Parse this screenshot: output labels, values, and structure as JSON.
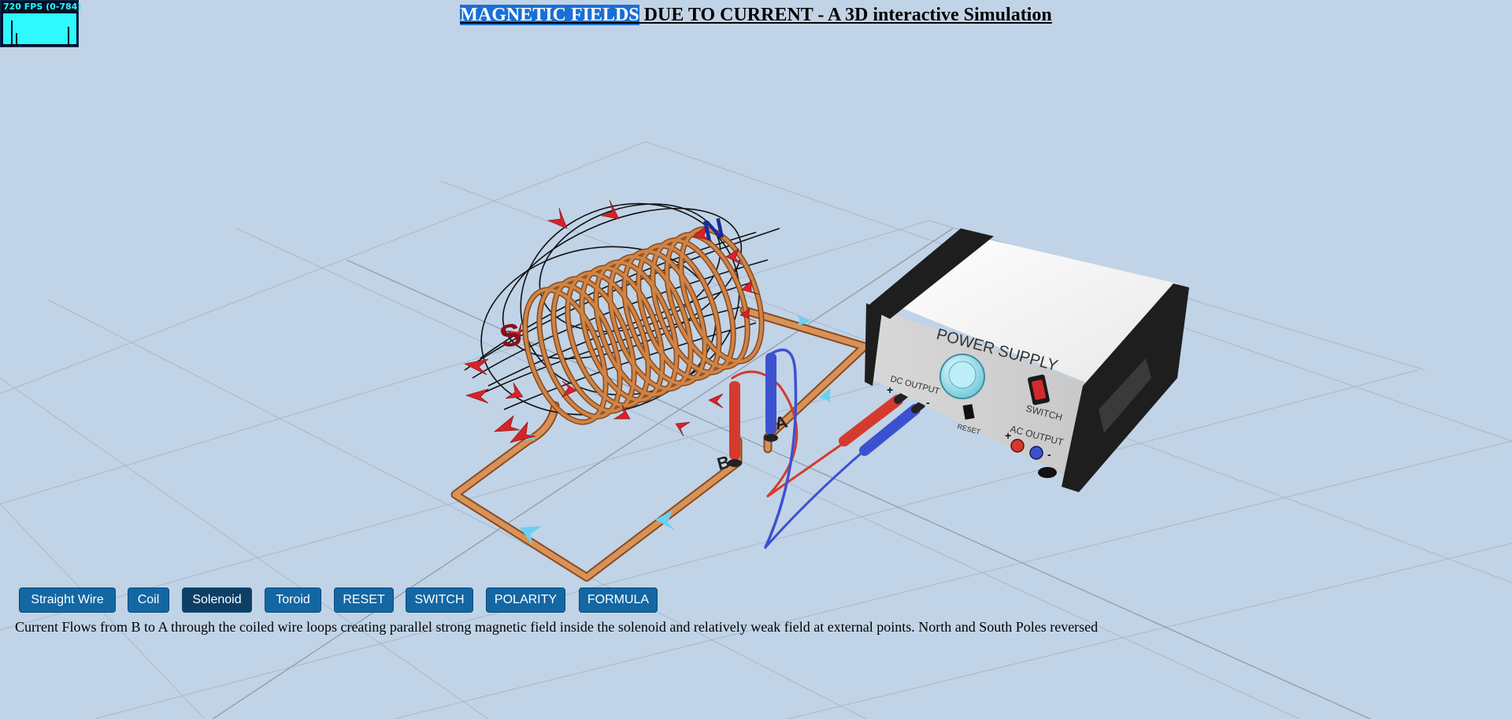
{
  "fps": {
    "label": "720 FPS (0-784)"
  },
  "title": {
    "highlighted": "MAGNETIC FIELDS",
    "rest": " DUE TO CURRENT - A 3D interactive Simulation"
  },
  "scene": {
    "north_label": "N",
    "south_label": "S",
    "terminal_a": "A",
    "terminal_b": "B",
    "power_supply": {
      "title": "POWER SUPPLY",
      "dc_output": "DC OUTPUT",
      "ac_output": "AC OUTPUT",
      "switch": "SWITCH",
      "reset": "RESET",
      "plus": "+",
      "minus": "-"
    }
  },
  "toolbar": {
    "buttons": [
      {
        "label": "Straight Wire",
        "active": false
      },
      {
        "label": "Coil",
        "active": false
      },
      {
        "label": "Solenoid",
        "active": true
      },
      {
        "label": "Toroid",
        "active": false
      },
      {
        "label": "RESET",
        "active": false
      },
      {
        "label": "SWITCH",
        "active": false
      },
      {
        "label": "POLARITY",
        "active": false
      },
      {
        "label": "FORMULA",
        "active": false
      }
    ]
  },
  "description": "Current Flows from B to A through the coiled wire loops creating parallel strong magnetic field inside the solenoid and relatively weak field at external points. North and South Poles reversed",
  "colors": {
    "background": "#c1d3e6",
    "button": "#1367a3",
    "button_active": "#0d3f66",
    "copper": "#c8763a",
    "arrow_red": "#d8222a",
    "arrow_cyan": "#6ad0f0",
    "probe_red": "#d43a2e",
    "probe_blue": "#3b52d0"
  }
}
